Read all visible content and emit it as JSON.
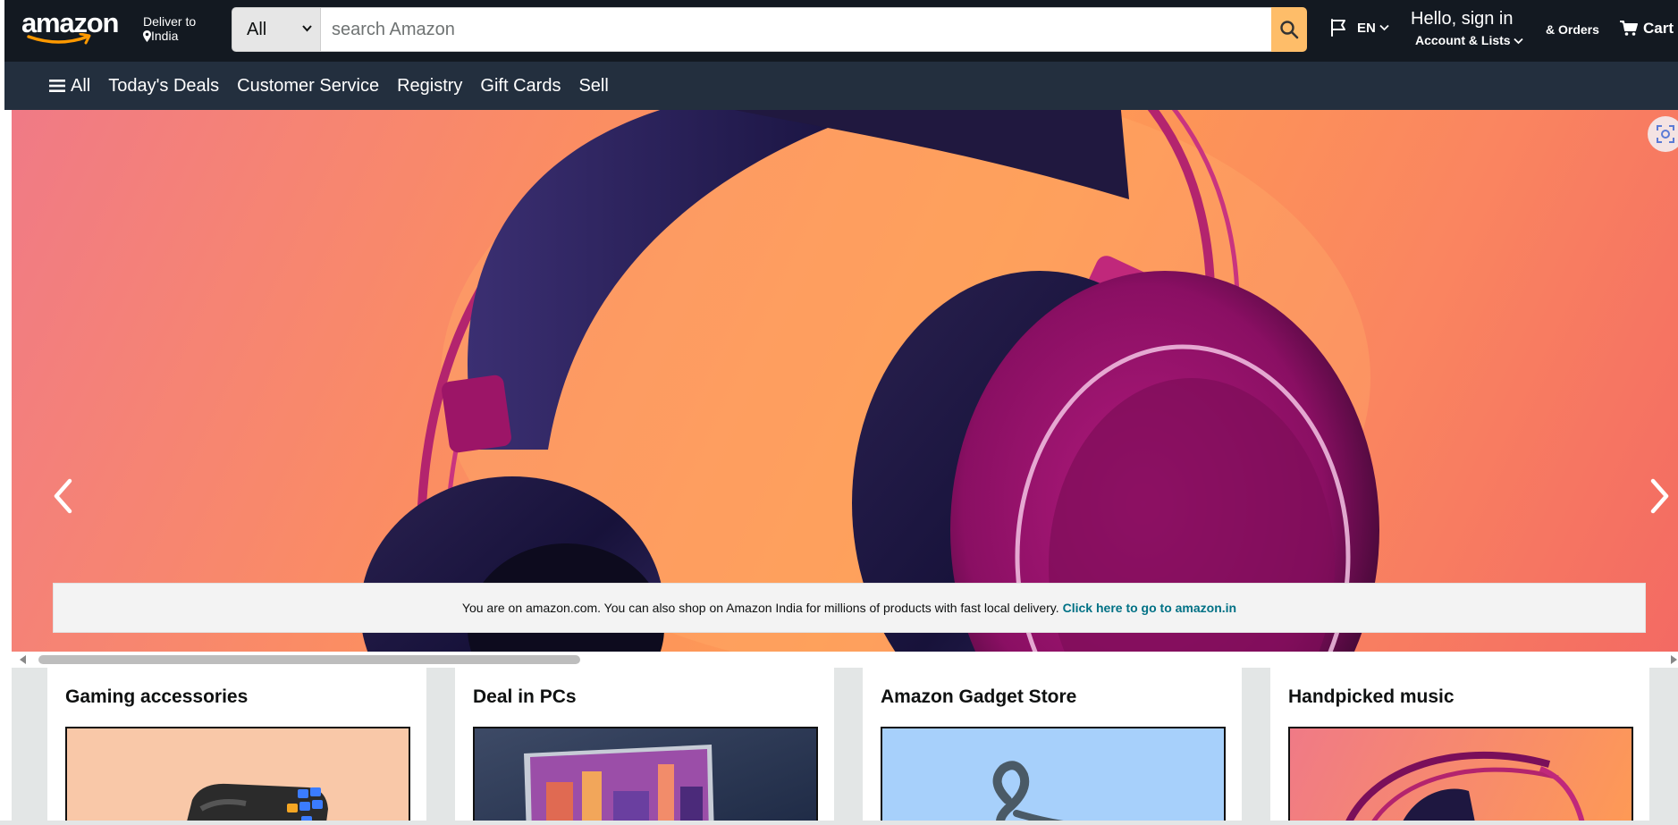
{
  "header": {
    "logo_text": "amazon",
    "deliver_line1": "Deliver to",
    "deliver_line2": "India",
    "search": {
      "category": "All",
      "placeholder": "search Amazon"
    },
    "language": "EN",
    "signin_line1": "Hello, sign in",
    "signin_line2": "Account & Lists",
    "orders": "& Orders",
    "cart": "Cart"
  },
  "subnav": {
    "items": [
      {
        "label": "All"
      },
      {
        "label": "Today's Deals"
      },
      {
        "label": "Customer Service"
      },
      {
        "label": "Registry"
      },
      {
        "label": "Gift Cards"
      },
      {
        "label": "Sell"
      }
    ]
  },
  "hero": {
    "notice_text": "You are on amazon.com. You can also shop on Amazon India for millions of products with fast local delivery.",
    "notice_link": "Click here to go to amazon.in"
  },
  "cards": [
    {
      "title": "Gaming accessories"
    },
    {
      "title": "Deal in PCs"
    },
    {
      "title": "Amazon Gadget Store"
    },
    {
      "title": "Handpicked music"
    }
  ],
  "colors": {
    "header_bg": "#131921",
    "subnav_bg": "#232f3e",
    "search_button": "#febd69",
    "link": "#007185"
  }
}
